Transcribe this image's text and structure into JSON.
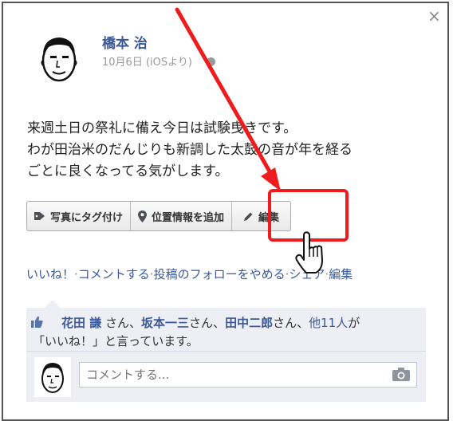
{
  "post": {
    "author": "橋本 治",
    "date": "10月6日 (iOSより)",
    "lines": [
      "来週土日の祭礼に備え今日は試験曳きです。",
      "わが田治米のだんじりも新調した太鼓の音が年を経る",
      "ごとに良くなってる気がします。"
    ]
  },
  "actions": {
    "tag_photo": "写真にタグ付け",
    "add_location": "位置情報を追加",
    "edit": "編集"
  },
  "links": {
    "like": "いいね！",
    "comment": "コメントする",
    "follow": "投稿のフォローをやめる",
    "share": "シェア",
    "edit": "編集"
  },
  "likes": {
    "name1": "花田 謙",
    "name2": "坂本一三",
    "name3": "田中二郎",
    "suffix": "さん、",
    "others": "他11人",
    "tail_ga": "が",
    "tail": "「いいね！」と言っています。"
  },
  "comment": {
    "placeholder": "コメントする..."
  },
  "colors": {
    "link": "#3b5998",
    "highlight": "#ee1c1c"
  },
  "icons": [
    "close-icon",
    "globe-icon",
    "tag-icon",
    "location-pin-icon",
    "pencil-icon",
    "thumbs-up-icon",
    "camera-icon",
    "hand-cursor-icon"
  ]
}
